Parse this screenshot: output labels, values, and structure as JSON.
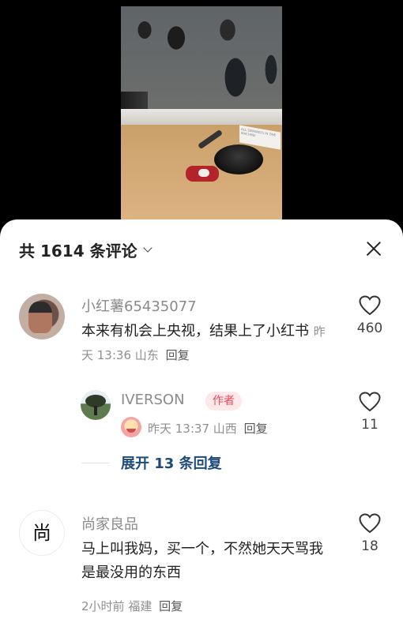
{
  "video": {
    "sign_text": "ALL DEMANDS IN ONE MACHINE"
  },
  "comments_header": {
    "title": "共 1614 条评论"
  },
  "comments": [
    {
      "user": "小红薯65435077",
      "text": "本来有机会上央视，结果上了小红书",
      "time": "昨天 13:36",
      "location": "山东",
      "reply_label": "回复",
      "likes": "460"
    },
    {
      "user": "尚家良品",
      "text": "马上叫我妈，买一个，不然她天天骂我是最没用的东西",
      "time": "2小时前",
      "location": "福建",
      "reply_label": "回复",
      "likes": "18"
    }
  ],
  "reply": {
    "user": "IVERSON",
    "tag": "作者",
    "time": "昨天 13:37",
    "location": "山西",
    "reply_label": "回复",
    "likes": "11"
  },
  "expand_replies": "展开 13 条回复",
  "avatar3_logo": "尚",
  "icons": {
    "like": "heart-icon",
    "close": "close-icon",
    "expand_header": "chevron-down-icon"
  },
  "colors": {
    "author_tag_bg": "#fde8ea",
    "author_tag_text": "#e94a5a",
    "expand_link": "#1d4a7a"
  }
}
